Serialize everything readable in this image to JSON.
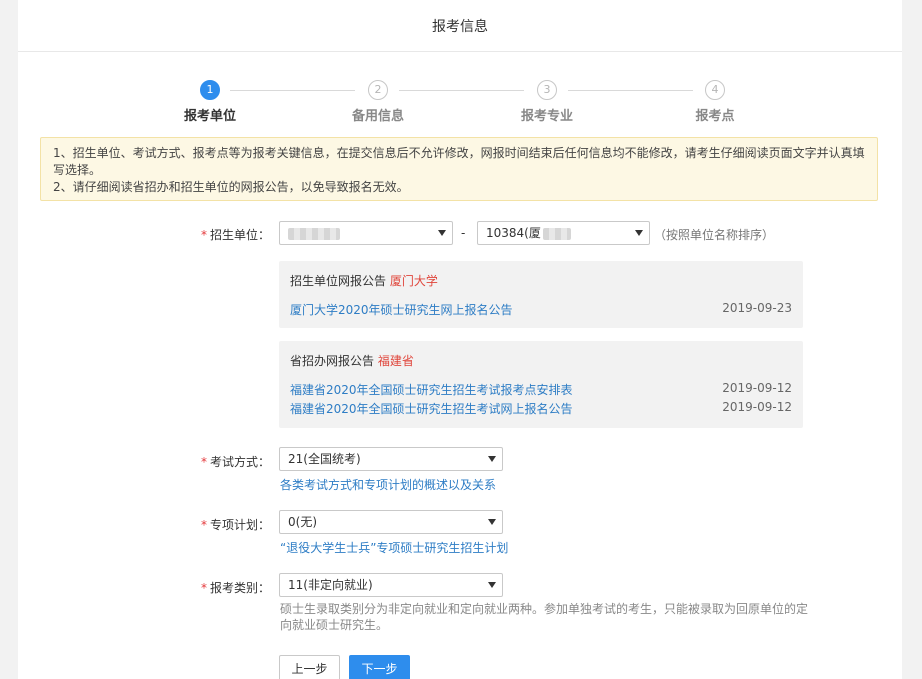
{
  "header": {
    "title": "报考信息"
  },
  "steps": [
    {
      "num": "1",
      "label": "报考单位"
    },
    {
      "num": "2",
      "label": "备用信息"
    },
    {
      "num": "3",
      "label": "报考专业"
    },
    {
      "num": "4",
      "label": "报考点"
    }
  ],
  "notice": {
    "line1": "1、招生单位、考试方式、报考点等为报考关键信息，在提交信息后不允许修改，网报时间结束后任何信息均不能修改，请考生仔细阅读页面文字并认真填写选择。",
    "line2": "2、请仔细阅读省招办和招生单位的网报公告，以免导致报名无效。"
  },
  "unit": {
    "label": "招生单位：",
    "separator": "-",
    "select2_value": "10384(厦",
    "sort_hint": "（按照单位名称排序）"
  },
  "unit_notice": {
    "title": "招生单位网报公告",
    "title_highlight": "厦门大学",
    "items": [
      {
        "text": "厦门大学2020年硕士研究生网上报名公告",
        "date": "2019-09-23"
      }
    ]
  },
  "province_notice": {
    "title": "省招办网报公告",
    "title_highlight": "福建省",
    "items": [
      {
        "text": "福建省2020年全国硕士研究生招生考试报考点安排表",
        "date": "2019-09-12"
      },
      {
        "text": "福建省2020年全国硕士研究生招生考试网上报名公告",
        "date": "2019-09-12"
      }
    ]
  },
  "exam_mode": {
    "label": "考试方式：",
    "value": "21(全国统考)",
    "link": "各类考试方式和专项计划的概述以及关系"
  },
  "special_plan": {
    "label": "专项计划：",
    "value": "0(无)",
    "link": "“退役大学生士兵”专项硕士研究生招生计划"
  },
  "category": {
    "label": "报考类别：",
    "value": "11(非定向就业)",
    "desc": "硕士生录取类别分为非定向就业和定向就业两种。参加单独考试的考生，只能被录取为回原单位的定向就业硕士研究生。"
  },
  "buttons": {
    "prev": "上一步",
    "next": "下一步"
  },
  "colors": {
    "accent": "#2e8ded",
    "link": "#2e7dc5",
    "highlight": "#e0453b",
    "notice_bg": "#fdf8e4"
  }
}
